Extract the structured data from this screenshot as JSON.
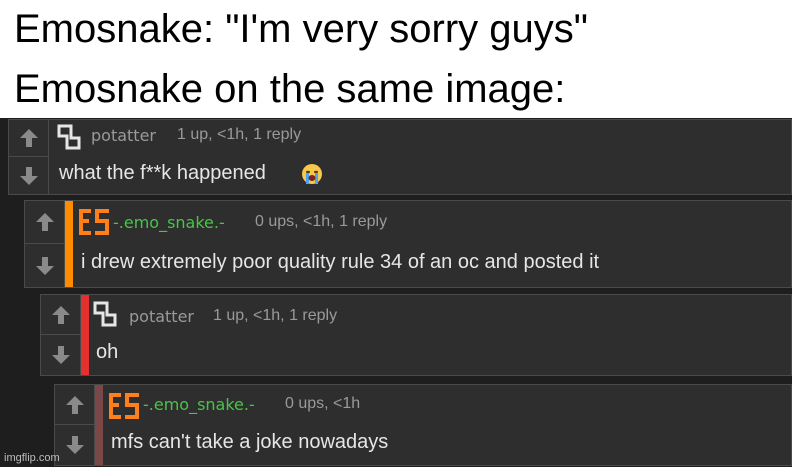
{
  "captions": {
    "line1": "Emosnake: \"I'm very sorry guys\"",
    "line2": "Emosnake on the same image:"
  },
  "colors": {
    "bar_orange": "#ff8c00",
    "bar_red": "#e53030",
    "bar_maroon": "#7a4848",
    "username_green": "#46c646",
    "avatar_es_orange": "#ff7f1a"
  },
  "comments": [
    {
      "username": "potatter",
      "meta": "1 up, <1h, 1 reply",
      "text": "what the f**k happened",
      "avatar_icon": "potatter-avatar-icon",
      "emoji_icon": "loudly-crying-face-icon"
    },
    {
      "username": "-.emo_snake.-",
      "meta": "0 ups, <1h, 1 reply",
      "text": "i drew extremely poor quality rule 34 of an oc and posted it",
      "avatar_icon": "es-avatar-icon"
    },
    {
      "username": "potatter",
      "meta": "1 up, <1h, 1 reply",
      "text": "oh",
      "avatar_icon": "potatter-avatar-icon"
    },
    {
      "username": "-.emo_snake.-",
      "meta": "0 ups, <1h",
      "text": "mfs can't take a joke nowadays",
      "avatar_icon": "es-avatar-icon"
    }
  ],
  "watermark": "imgflip.com"
}
